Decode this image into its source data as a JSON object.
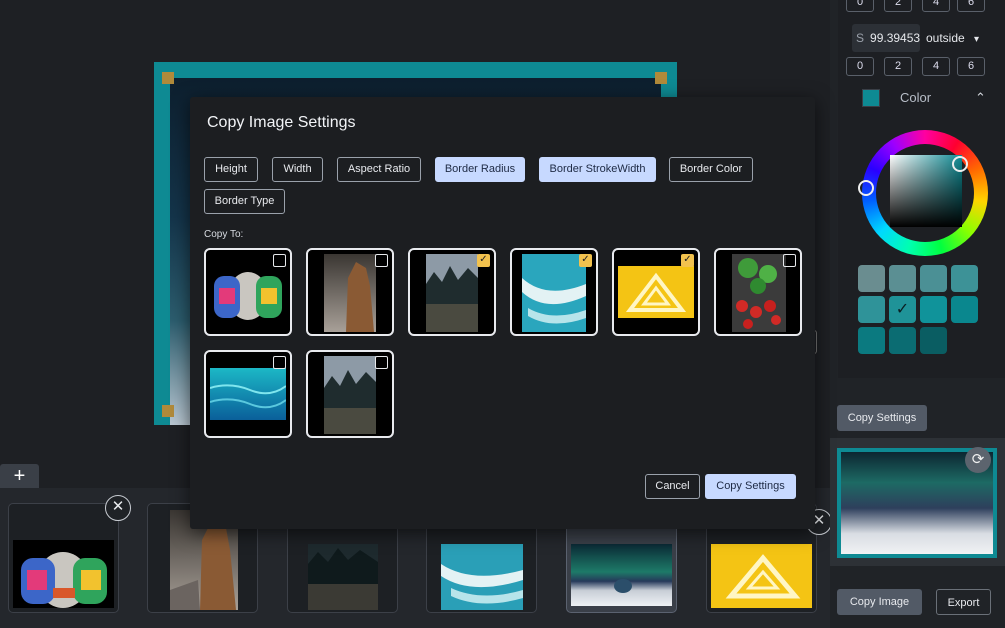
{
  "panel": {
    "top_numbers": [
      "0",
      "2",
      "4",
      "6"
    ],
    "size_prefix": "S",
    "size_value": "99.39453",
    "position_value": "outside",
    "chevron_down": "▾",
    "bottom_numbers": [
      "0",
      "2",
      "4",
      "6"
    ],
    "color_label": "Color",
    "color_chevron": "⌃",
    "accent_color": "#0e8a93",
    "palette": [
      "#6a8d90",
      "#5b8f93",
      "#4b9095",
      "#3d9297",
      "#2f9399",
      "#1f9398",
      "#10939a",
      "#0a878e",
      "#0b7a80",
      "#0b6c72",
      "#0a5d62"
    ],
    "palette_checked_index": 5,
    "copy_settings_label": "Copy Settings",
    "refresh_icon": "⟳",
    "copy_image_label": "Copy Image",
    "export_label": "Export"
  },
  "canvas": {
    "add_slide_label": "+"
  },
  "filmstrip": {
    "close_icon": "✕",
    "items": [
      {
        "name": "painted-hands"
      },
      {
        "name": "rock-formation"
      },
      {
        "name": "forest-lake"
      },
      {
        "name": "surfers-wave"
      },
      {
        "name": "aurora-igloo",
        "active": true
      },
      {
        "name": "yellow-triangle"
      }
    ]
  },
  "modal": {
    "title": "Copy Image Settings",
    "settings": [
      {
        "label": "Height",
        "selected": false
      },
      {
        "label": "Width",
        "selected": false
      },
      {
        "label": "Aspect Ratio",
        "selected": false
      },
      {
        "label": "Border Radius",
        "selected": true
      },
      {
        "label": "Border StrokeWidth",
        "selected": true
      },
      {
        "label": "Border Color",
        "selected": false
      },
      {
        "label": "Border Type",
        "selected": false
      }
    ],
    "copy_to_label": "Copy To:",
    "targets": [
      {
        "name": "painted-hands",
        "checked": false
      },
      {
        "name": "rock-formation",
        "checked": false
      },
      {
        "name": "forest-lake",
        "checked": true
      },
      {
        "name": "surfers-wave",
        "checked": true
      },
      {
        "name": "yellow-triangle",
        "checked": true
      },
      {
        "name": "tomatoes-basil",
        "checked": false
      },
      {
        "name": "turquoise-water",
        "checked": false
      },
      {
        "name": "misty-forest",
        "checked": false
      }
    ],
    "check_mark": "✓",
    "cancel_label": "Cancel",
    "copy_settings_label": "Copy Settings"
  }
}
